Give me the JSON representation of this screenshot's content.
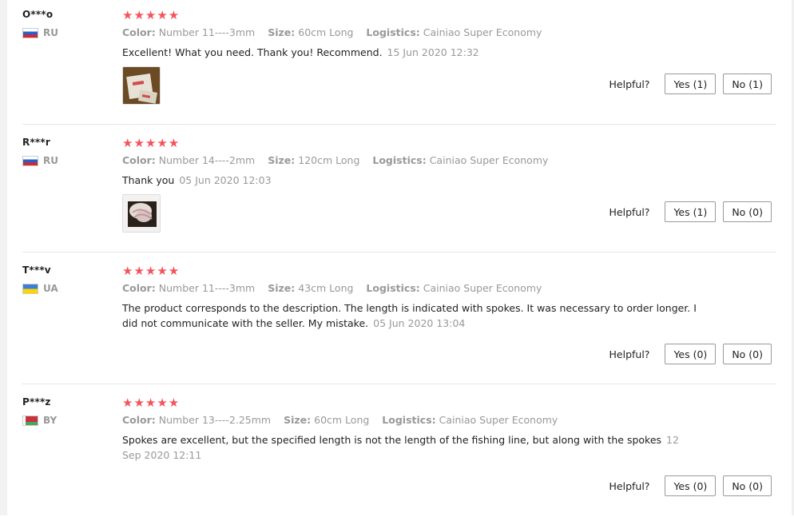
{
  "labels": {
    "color": "Color:",
    "size": "Size:",
    "logistics": "Logistics:",
    "helpful": "Helpful?"
  },
  "star_glyphs": "★★★★★",
  "reviews": [
    {
      "user": "O***o",
      "country": "RU",
      "rating": 5,
      "color": "Number 11----3mm",
      "size": "60cm Long",
      "logistics": "Cainiao Super Economy",
      "text": "Excellent! What you need. Thank you! Recommend.",
      "date": "15 Jun 2020 12:32",
      "yes": "Yes (1)",
      "no": "No (1)"
    },
    {
      "user": "R***r",
      "country": "RU",
      "rating": 5,
      "color": "Number 14----2mm",
      "size": "120cm Long",
      "logistics": "Cainiao Super Economy",
      "text": "Thank you",
      "date": "05 Jun 2020 12:03",
      "yes": "Yes (1)",
      "no": "No (0)"
    },
    {
      "user": "T***v",
      "country": "UA",
      "rating": 5,
      "color": "Number 11----3mm",
      "size": "43cm Long",
      "logistics": "Cainiao Super Economy",
      "text": "The product corresponds to the description. The length is indicated with spokes. It was necessary to order longer. I did not communicate with the seller. My mistake.",
      "date": "05 Jun 2020 13:04",
      "yes": "Yes (0)",
      "no": "No (0)"
    },
    {
      "user": "P***z",
      "country": "BY",
      "rating": 5,
      "color": "Number 13----2.25mm",
      "size": "60cm Long",
      "logistics": "Cainiao Super Economy",
      "text": "Spokes are excellent, but the specified length is not the length of the fishing line, but along with the spokes",
      "date": "12 Sep 2020 12:11",
      "yes": "Yes (0)",
      "no": "No (0)"
    }
  ]
}
